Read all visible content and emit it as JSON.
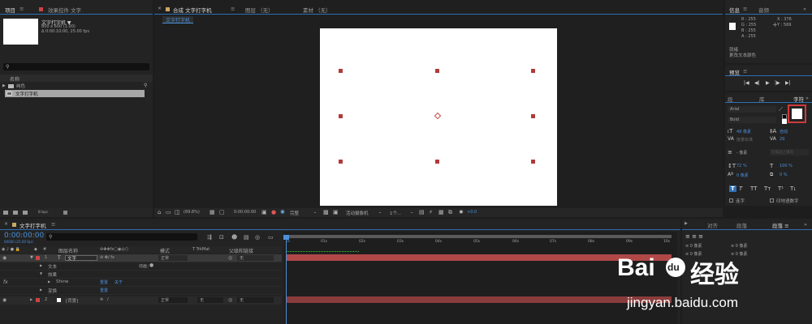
{
  "project": {
    "tab": "项目",
    "tab_menu": "≡",
    "effects_tab": "效果控件 文字",
    "comp_name": "文字打字机 ▼",
    "size": "800 x 600 (1.00)",
    "duration": "Δ 0:00:10:00, 25.00 fps",
    "search_icon": "⚲",
    "name_header": "名称",
    "items": [
      "纯色",
      "文字打字机"
    ],
    "bpc": "8 bpc"
  },
  "viewer": {
    "tabs": [
      "合成 文字打字机",
      "图层 （无）",
      "素材 （无）"
    ],
    "tab_menu": "≡",
    "sub_tab": "文字打字机",
    "zoom": "(69.8%)",
    "time": "0:00:00:00",
    "quality": "完整",
    "camera": "活动摄像机",
    "views": "1个...",
    "offset": "+0.0"
  },
  "info": {
    "tab": "信息",
    "audio_tab": "音频",
    "r": "R : 255",
    "g": "G : 255",
    "b": "B : 255",
    "a": "A : 255",
    "x": "X : 376",
    "y": "Y : 569",
    "line1": "就绪",
    "line2": "更改文本颜色"
  },
  "preview": {
    "tab": "预览",
    "buttons": [
      "|◀",
      "◀|",
      "▶",
      "|▶",
      "▶|"
    ]
  },
  "character": {
    "tab1": "段",
    "tab2": "库",
    "tab3": "字符",
    "font": "Arial",
    "style": "Bold",
    "size": "49 像素",
    "leading": "自动",
    "kerning": "度量标准",
    "tracking": "29",
    "stroke_width": "- 像素",
    "stroke_type": "在描边上填充",
    "vscale": "72 %",
    "hscale": "100 %",
    "baseline": "0 像素",
    "tsume": "0 %",
    "styles": [
      "T",
      "T",
      "TT",
      "Tт",
      "T¹",
      "T₁"
    ],
    "ligature": "连字",
    "hindi": "印地语数字",
    "highlight_color": "#d03a3a"
  },
  "timeline": {
    "tab": "文字打字机",
    "tab_menu": "≡",
    "time": "0:00:00:00",
    "time_sub": "00000 (25.00 fps)",
    "cols": {
      "name": "图层名称",
      "mode": "模式",
      "trk": "T TrkMat",
      "parent": "父级和链接"
    },
    "layers": [
      {
        "num": "1",
        "name": "文字",
        "mode": "正常",
        "parent": "无"
      },
      {
        "num": "2",
        "name": "[背景]",
        "mode": "正常",
        "trk": "无",
        "parent": "无"
      }
    ],
    "sub": {
      "text": "文本",
      "effects": "效果",
      "shine": "Shine",
      "reset": "重置",
      "about": "关于",
      "transform": "变换",
      "reset2": "重置",
      "anim": "动画："
    },
    "ruler": [
      "0s",
      "01s",
      "02s",
      "03s",
      "04s",
      "05s",
      "06s",
      "07s",
      "08s",
      "09s",
      "10s"
    ]
  },
  "right_bottom": {
    "tabs": [
      "▶",
      "对齐",
      "段落",
      "段落 ≡"
    ],
    "labels": [
      "≡ 0 像素",
      "≡ 0 像素",
      "≡ 0 像素",
      "≡ 0 像素"
    ]
  },
  "watermark": {
    "logo": "Bai",
    "logo2": "du",
    "text": "经验",
    "url": "jingyan.baidu.com"
  }
}
